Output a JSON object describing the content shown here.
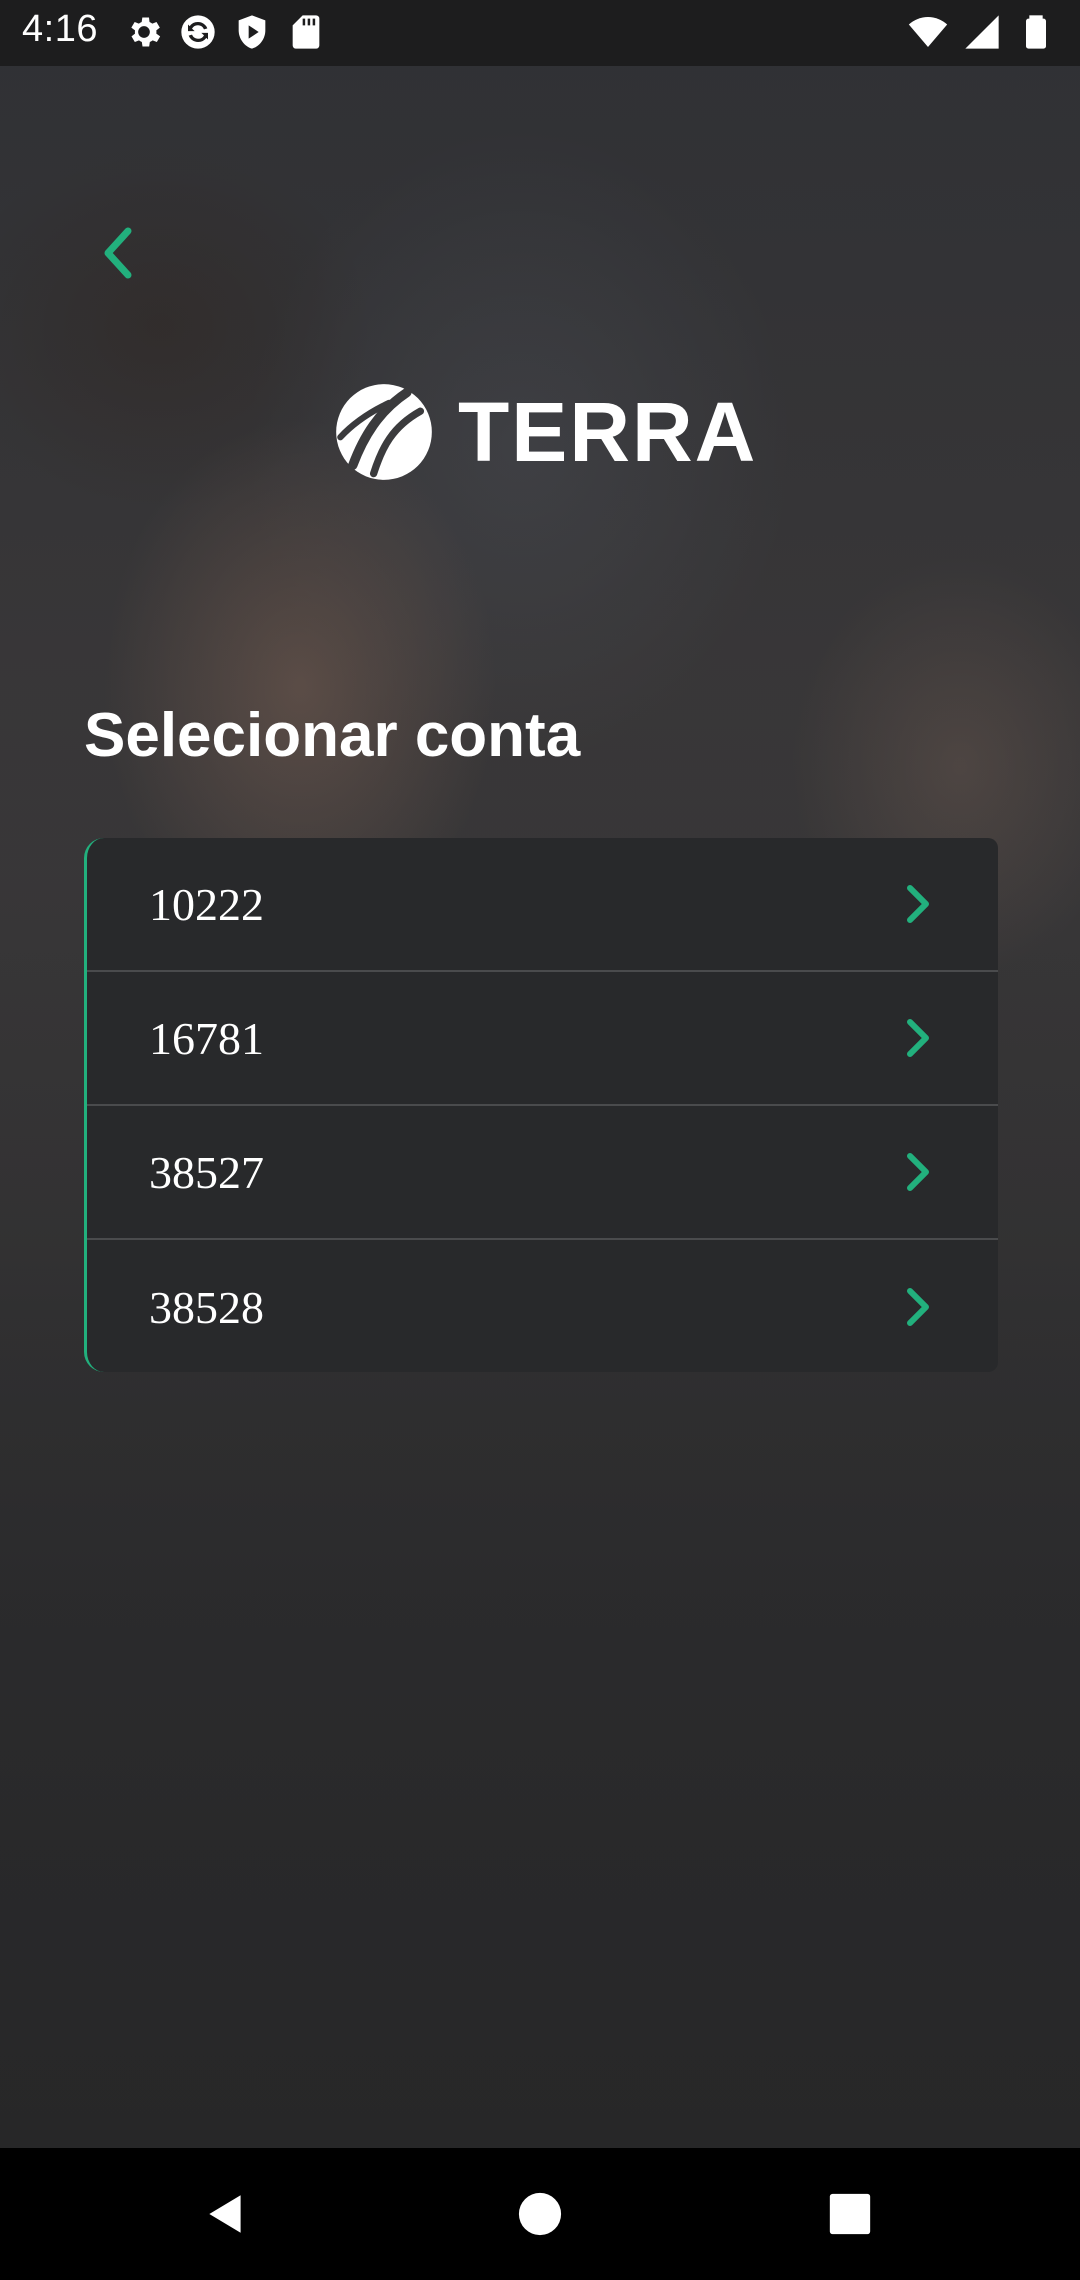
{
  "status_bar": {
    "time": "4:16",
    "left_icons": [
      "settings-icon",
      "sync-icon",
      "shield-icon",
      "sd-card-icon"
    ],
    "right_icons": [
      "wifi-icon",
      "signal-icon",
      "battery-icon"
    ]
  },
  "colors": {
    "accent": "#22b07d",
    "card_background": "#28292b",
    "status_bar": "#1d1d1e"
  },
  "header": {
    "back_icon": "chevron-left-icon",
    "logo_text": "TERRA"
  },
  "main": {
    "title": "Selecionar conta",
    "accounts": [
      {
        "number": "10222"
      },
      {
        "number": "16781"
      },
      {
        "number": "38527"
      },
      {
        "number": "38528"
      }
    ]
  },
  "nav_bar": {
    "buttons": [
      "back",
      "home",
      "recents"
    ]
  }
}
